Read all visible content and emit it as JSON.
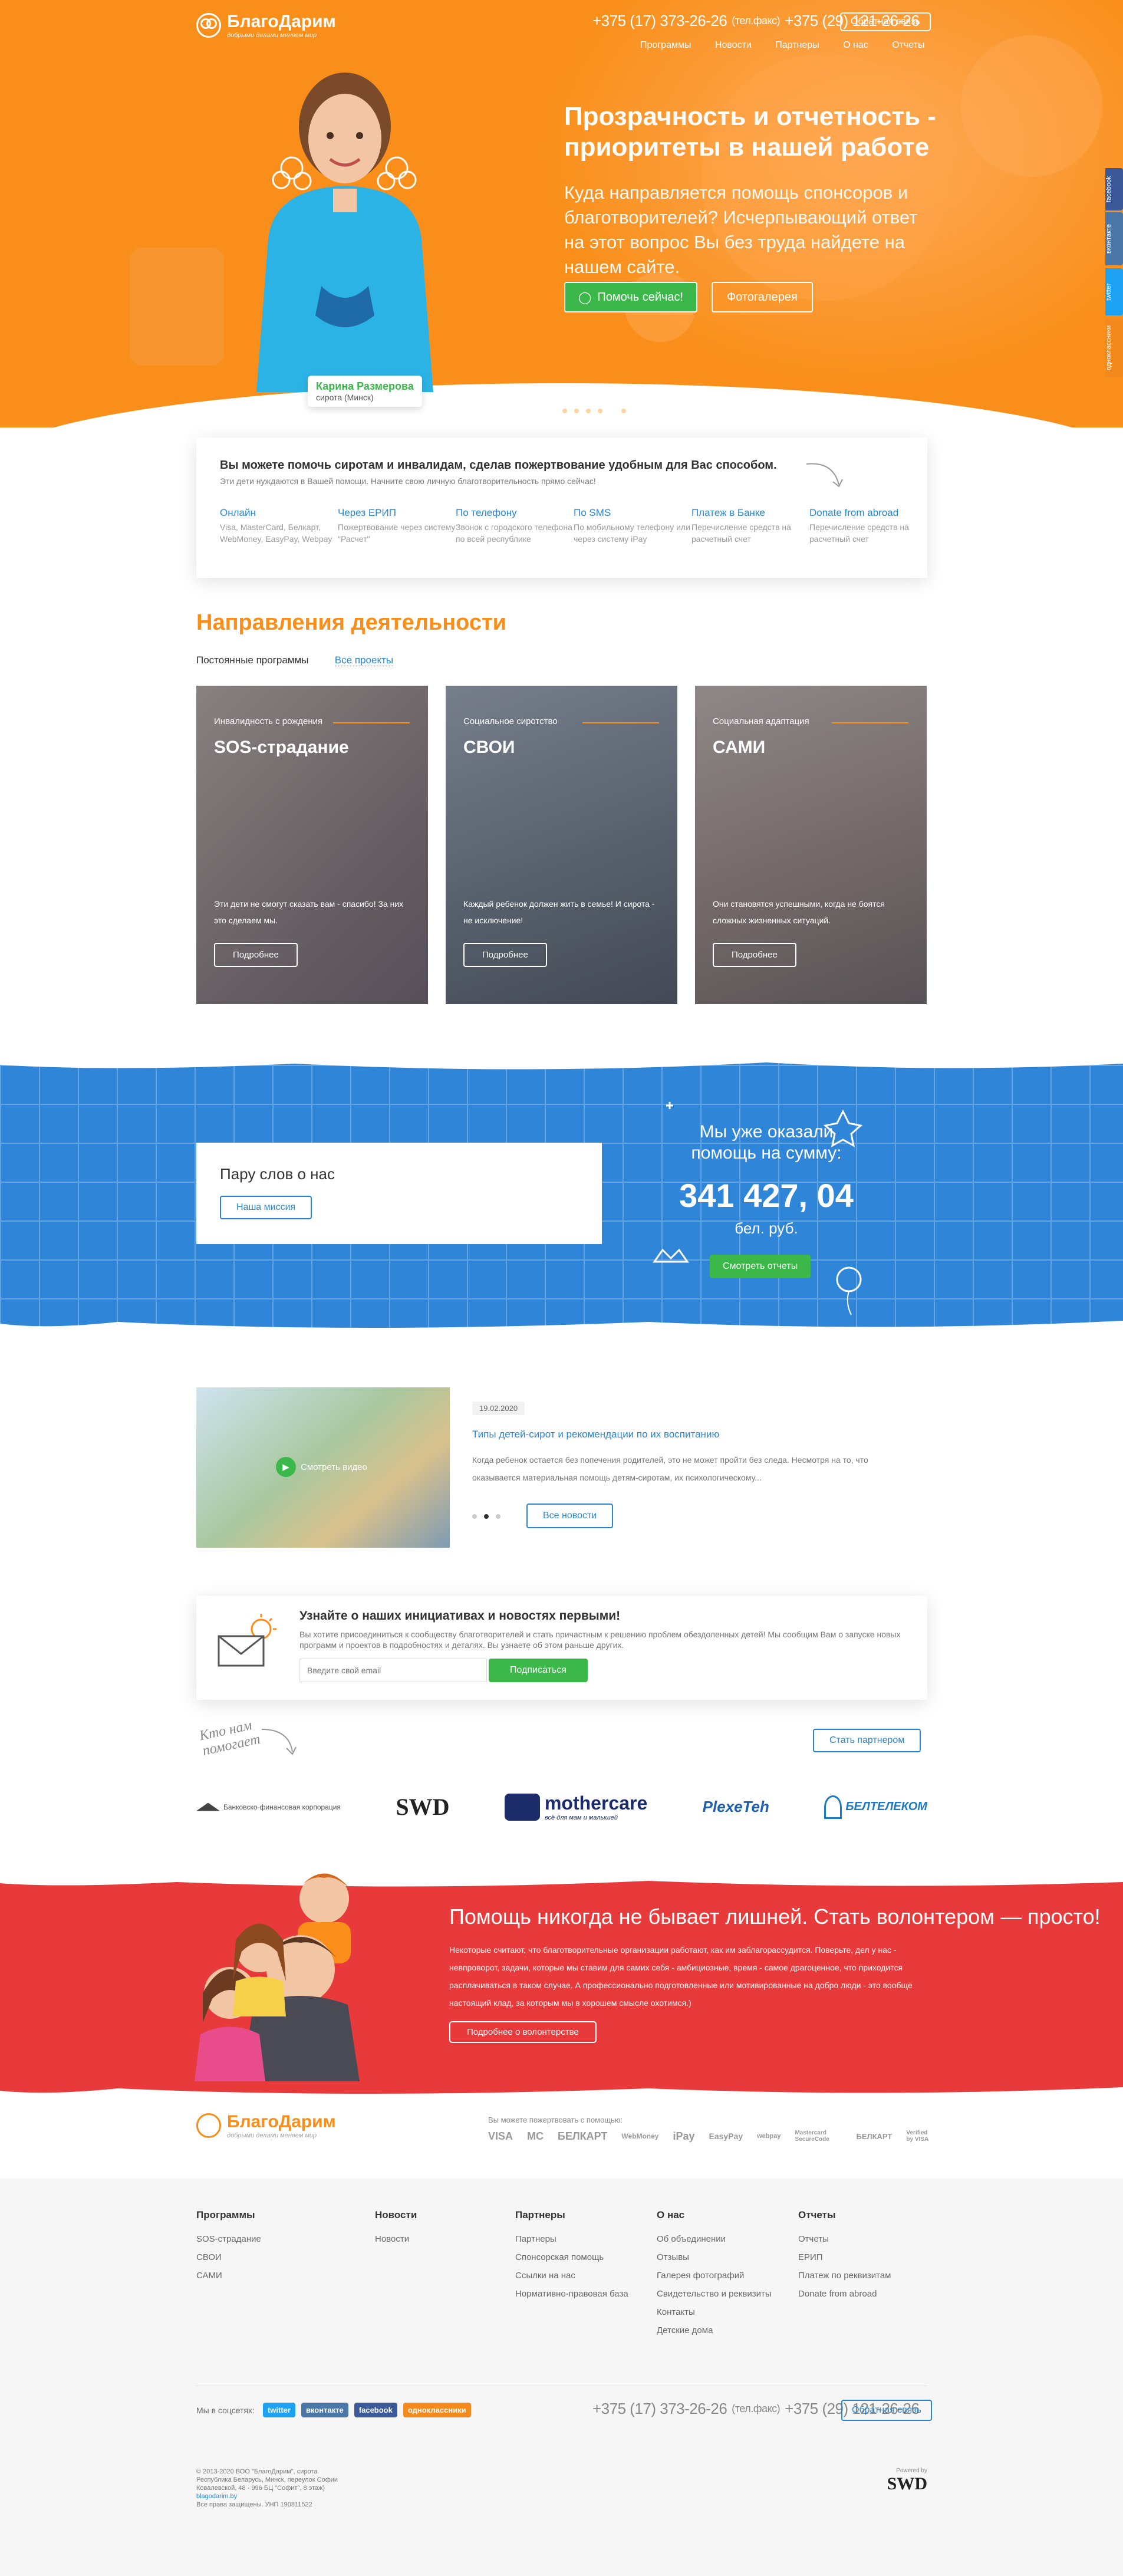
{
  "brand": {
    "name": "БлагоДарим",
    "tagline": "добрыми делами меняем мир"
  },
  "header": {
    "phone1": "+375 (17) 373-26-26",
    "phone1_note": "(тел.факс)",
    "phone2": "+375 (29) 121-26-26",
    "feedback": "Обратная связь",
    "nav": [
      "Программы",
      "Новости",
      "Партнеры",
      "О нас",
      "Отчеты"
    ]
  },
  "hero": {
    "title": "Прозрачность и отчетность - приоритеты в нашей работе",
    "lead": "Куда направляется помощь спонсоров и благотворителей? Исчерпывающий ответ на этот вопрос Вы без труда найдете на нашем сайте.",
    "cta": "Помочь сейчас!",
    "gallery": "Фотогалерея",
    "child_name": "Карина Размерова",
    "child_note": "сирота (Минск)",
    "slide_count": 6,
    "active_slide": 5
  },
  "side_social": [
    {
      "label": "facebook",
      "color": "#3b5998"
    },
    {
      "label": "вконтакте",
      "color": "#4a76a8"
    },
    {
      "label": "twitter",
      "color": "#1da1f2"
    },
    {
      "label": "одноклассники",
      "color": "#f48a1e"
    }
  ],
  "donate": {
    "title": "Вы можете помочь сиротам и инвалидам, сделав пожертвование удобным для Вас способом.",
    "subtitle": "Эти дети нуждаются в Вашей помощи. Начните свою личную благотворительность прямо сейчас!",
    "methods": [
      {
        "title": "Онлайн",
        "text": "Visa, MasterCard, Белкарт, WebMoney, EasyPay, Webpay"
      },
      {
        "title": "Через ЕРИП",
        "text": "Пожертвование через систему \"Расчет\""
      },
      {
        "title": "По телефону",
        "text": "Звонок с городского телефона по всей республике"
      },
      {
        "title": "По SMS",
        "text": "По мобильному телефону или через систему iPay"
      },
      {
        "title": "Платеж в Банке",
        "text": "Перечисление средств на расчетный счет"
      },
      {
        "title": "Donate from abroad",
        "text": "Перечисление средств на расчетный счет"
      }
    ]
  },
  "directions": {
    "title": "Направления деятельности",
    "tabs": [
      "Постоянные программы",
      "Все проекты"
    ],
    "cards": [
      {
        "category": "Инвалидность с рождения",
        "title": "SOS-страдание",
        "text": "Эти дети не смогут сказать вам - спасибо! За них это сделаем мы.",
        "more": "Подробнее"
      },
      {
        "category": "Социальное сиротство",
        "title": "СВОИ",
        "text": "Каждый ребенок должен жить в семье! И сирота - не исключение!",
        "more": "Подробнее"
      },
      {
        "category": "Социальная адаптация",
        "title": "САМИ",
        "text": "Они становятся успешными, когда не боятся сложных жизненных ситуаций.",
        "more": "Подробнее"
      }
    ]
  },
  "about": {
    "title": "Пару слов о нас",
    "mission": "Наша миссия",
    "sum_label": "Мы уже оказали помощь на сумму:",
    "sum": "341 427, 04",
    "currency": "бел. руб.",
    "reports": "Смотреть отчеты"
  },
  "news": {
    "video": "Смотреть видео",
    "date": "19.02.2020",
    "title": "Типы детей-сирот и рекомендации по их воспитанию",
    "text": "Когда ребенок остается без попечения родителей, это не может пройти без следа. Несмотря на то, что оказывается материальная помощь детям-сиротам, их психологическому...",
    "all": "Все новости",
    "dots": 3,
    "active_dot": 2
  },
  "subscribe": {
    "title": "Узнайте о наших инициативах и новостях первыми!",
    "text": "Вы хотите присоединиться к сообществу благотворителей и стать причастным к решению проблем обездоленных детей! Мы сообщим Вам о запуске новых программ и проектов в подробностях и деталях. Вы узнаете об этом раньше других.",
    "placeholder": "Введите свой email",
    "button": "Подписаться"
  },
  "partners": {
    "who": "Кто нам помогает",
    "become": "Стать партнером",
    "list": [
      "Банковско-финансовая корпорация",
      "SWD",
      "mothercare",
      "PlexeTeh",
      "БЕЛТЕЛЕКОМ"
    ],
    "mothercare_tag": "всё для мам и малышей"
  },
  "volunteer": {
    "title": "Помощь никогда не бывает лишней. Стать волонтером — просто!",
    "text": "Некоторые считают, что благотворительные организации работают, как им заблагорассудится. Поверьте, дел у нас - невпроворот, задачи, которые мы ставим для самих себя - амбициозные, время - самое драгоценное, что приходится расплачиваться в таком случае. А профессионально подготовленные или мотивированные на добро люди - это вообще настоящий клад, за которым мы в хорошем смысле охотимся.)",
    "more": "Подробнее о волонтерстве"
  },
  "footer": {
    "pay_note": "Вы можете пожертвовать с помощью:",
    "pay_logos": [
      "VISA",
      "MC",
      "БЕЛКАРТ",
      "WebMoney",
      "iPay",
      "EasyPay",
      "webpay",
      "Mastercard SecureCode",
      "БЕЛКАРТ",
      "Verified by VISA"
    ],
    "cols": [
      {
        "title": "Программы",
        "links": [
          "SOS-страдание",
          "СВОИ",
          "САМИ"
        ]
      },
      {
        "title": "Новости",
        "links": [
          "Новости"
        ]
      },
      {
        "title": "Партнеры",
        "links": [
          "Партнеры",
          "Спонсорская помощь",
          "Ссылки на нас",
          "Нормативно-правовая база"
        ]
      },
      {
        "title": "О нас",
        "links": [
          "Об объединении",
          "Отзывы",
          "Галерея фотографий",
          "Свидетельство и реквизиты",
          "Контакты",
          "Детские дома"
        ]
      },
      {
        "title": "Отчеты",
        "links": [
          "Отчеты",
          "ЕРИП",
          "Платеж по реквизитам",
          "Donate from abroad"
        ]
      }
    ],
    "social_label": "Мы в соцсетях:",
    "social": [
      {
        "label": "twitter",
        "color": "#1da1f2"
      },
      {
        "label": "вконтакте",
        "color": "#4a76a8"
      },
      {
        "label": "facebook",
        "color": "#3b5998"
      },
      {
        "label": "одноклассники",
        "color": "#f48a1e"
      }
    ],
    "copyright": [
      "© 2013-2020 ВОО \"БлагоДарим\", сирота",
      "Республика Беларусь, Минск, переулок Софии",
      "Ковалевской, 48 - 996 БЦ \"Софит\", 8 этаж)",
      "blagodarim.by",
      "Все права защищены. УНП 190811522"
    ],
    "powered": "Powered by",
    "dev": "SWD"
  },
  "colors": {
    "orange": "#f98f1a",
    "blue": "#2f86d8",
    "red": "#e83a3a",
    "green": "#3cb74a",
    "link": "#2a86d1"
  }
}
